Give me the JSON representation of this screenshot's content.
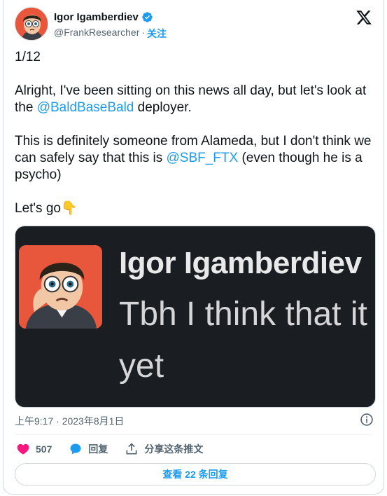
{
  "author": {
    "name": "Igor Igamberdiev",
    "handle": "@FrankResearcher",
    "separator": "·",
    "follow_label": "关注",
    "verified": true
  },
  "tweet": {
    "counter": "1/12",
    "p1_a": "Alright, I've been sitting on this news all day, but let's look at the ",
    "p1_mention": "@BaldBaseBald",
    "p1_b": " deployer.",
    "p2_a": "This is definitely someone from Alameda, but I don't think we can safely say that this is ",
    "p2_mention": "@SBF_FTX",
    "p2_b": " (even though he is a psycho)",
    "p3": "Let's go",
    "p3_emoji": "👇"
  },
  "media": {
    "name": "Igor Igamberdiev",
    "line1": "Tbh I think that it",
    "line2": "yet"
  },
  "meta": {
    "timestamp": "上午9:17 · 2023年8月1日"
  },
  "actions": {
    "likes": "507",
    "reply_label": "回复",
    "share_label": "分享这条推文"
  },
  "replies_button": "查看 22 条回复",
  "colors": {
    "accent": "#1d9bf0",
    "like": "#f91880",
    "text": "#0f1419",
    "muted": "#536471"
  }
}
